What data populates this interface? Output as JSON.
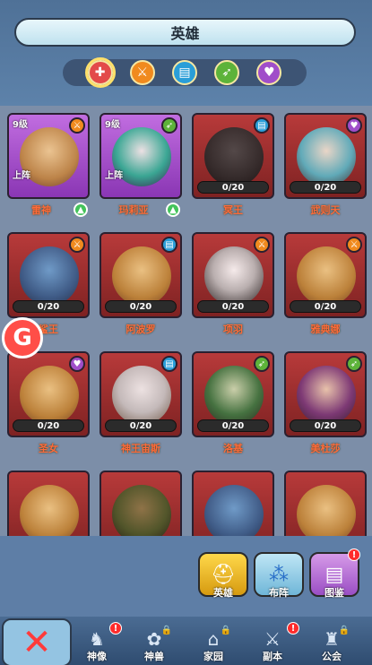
{
  "header": {
    "title": "英雄"
  },
  "filters": [
    {
      "icon": "all-icon",
      "color": "#e34a4a",
      "active": true
    },
    {
      "icon": "sword-icon",
      "color": "#f08a1e"
    },
    {
      "icon": "book-icon",
      "color": "#2a9ed8"
    },
    {
      "icon": "bow-icon",
      "color": "#5db33a"
    },
    {
      "icon": "heart-icon",
      "color": "#a04ec9"
    }
  ],
  "heroes": [
    {
      "name": "雷神",
      "level": "9级",
      "deploy": "上阵",
      "upgradeable": true,
      "style": "purple"
    },
    {
      "name": "玛莉亚",
      "level": "9级",
      "deploy": "上阵",
      "upgradeable": true,
      "style": "purple"
    },
    {
      "name": "冥王",
      "progress": "0/20"
    },
    {
      "name": "武则天",
      "progress": "0/20"
    },
    {
      "name": "鲨王",
      "progress": "0/20"
    },
    {
      "name": "阿波罗",
      "progress": "0/20"
    },
    {
      "name": "项羽",
      "progress": "0/20"
    },
    {
      "name": "雅典娜",
      "progress": "0/20"
    },
    {
      "name": "圣女",
      "progress": "0/20"
    },
    {
      "name": "神王宙斯",
      "progress": "0/20"
    },
    {
      "name": "洛基",
      "progress": "0/20"
    },
    {
      "name": "美杜莎",
      "progress": "0/20"
    },
    {
      "name": "",
      "progress": ""
    },
    {
      "name": "",
      "progress": ""
    },
    {
      "name": "",
      "progress": ""
    },
    {
      "name": "",
      "progress": ""
    }
  ],
  "actions": [
    {
      "label": "英雄",
      "icon": "helmet-icon",
      "badge": ""
    },
    {
      "label": "布阵",
      "icon": "formation-icon",
      "badge": ""
    },
    {
      "label": "图鉴",
      "icon": "codex-icon",
      "badge": "!"
    }
  ],
  "nav": [
    {
      "label": "神像",
      "icon": "statue-icon",
      "badge": "!"
    },
    {
      "label": "神兽",
      "icon": "paw-icon",
      "locked": true
    },
    {
      "label": "家园",
      "icon": "house-icon",
      "locked": true
    },
    {
      "label": "副本",
      "icon": "swords-icon",
      "badge": "!"
    },
    {
      "label": "公会",
      "icon": "castle-icon",
      "locked": true
    }
  ],
  "floating": {
    "label": "G"
  },
  "close": {
    "label": "✕"
  }
}
